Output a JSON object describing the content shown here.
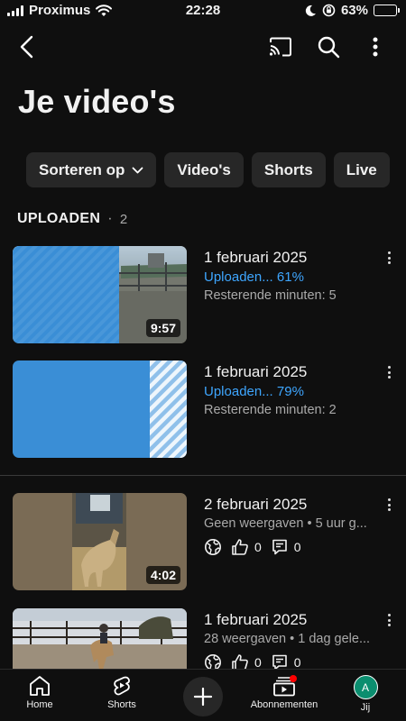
{
  "status_bar": {
    "carrier": "Proximus",
    "time": "22:28",
    "battery": "63%",
    "battery_level": 0.63
  },
  "header": {
    "title": "Je video's"
  },
  "chips": [
    {
      "label": "Sorteren op"
    },
    {
      "label": "Video's"
    },
    {
      "label": "Shorts"
    },
    {
      "label": "Live"
    }
  ],
  "section": {
    "label": "UPLOADEN",
    "separator": "·",
    "count": "2"
  },
  "uploads": [
    {
      "title": "1 februari 2025",
      "status": "Uploaden... 61%",
      "remaining": "Resterende minuten: 5",
      "duration": "9:57",
      "progress": 0.61
    },
    {
      "title": "1 februari 2025",
      "status": "Uploaden... 79%",
      "remaining": "Resterende minuten: 2",
      "progress": 0.79
    }
  ],
  "videos": [
    {
      "title": "2 februari 2025",
      "sub": "Geen weergaven • 5 uur g...",
      "duration": "4:02",
      "likes": "0",
      "comments": "0"
    },
    {
      "title": "1 februari 2025",
      "sub": "28 weergaven • 1 dag gele...",
      "likes": "0",
      "comments": "0"
    }
  ],
  "nav": {
    "home": "Home",
    "shorts": "Shorts",
    "subscriptions": "Abonnementen",
    "you": "Jij",
    "avatar_letter": "A"
  },
  "colors": {
    "background": "#0f0f0f",
    "accent": "#3ea6ff",
    "upload_blue": "#3a8ed6",
    "notification": "#ff0000"
  }
}
